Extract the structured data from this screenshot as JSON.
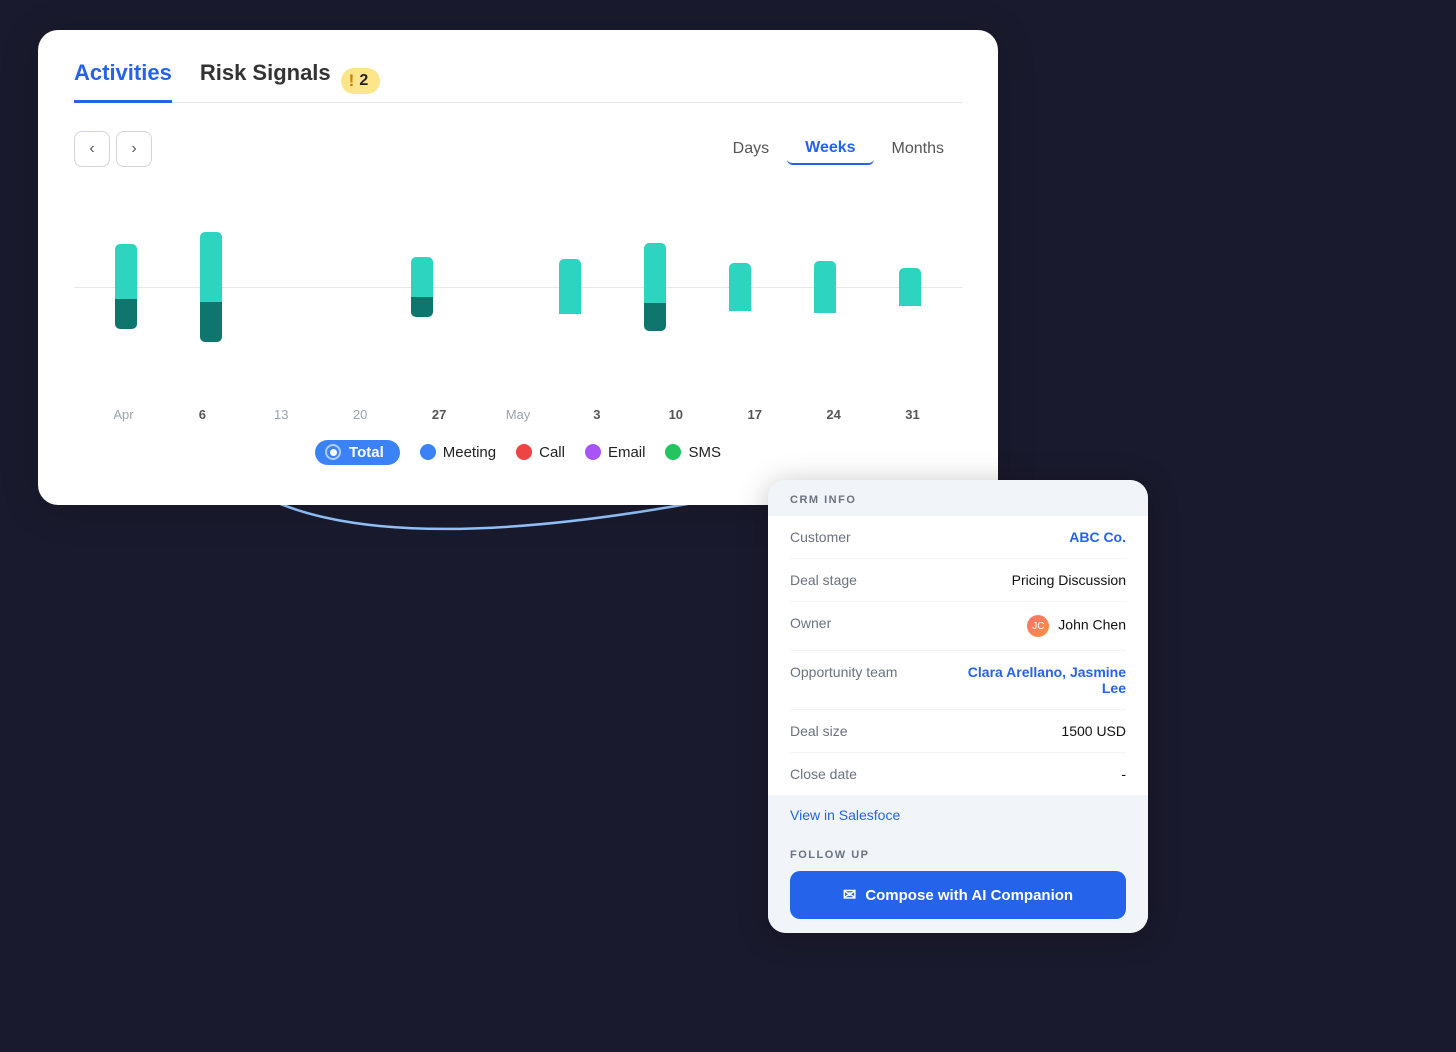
{
  "tabs": {
    "activities": "Activities",
    "risk_signals": "Risk Signals",
    "risk_count": "2"
  },
  "period": {
    "prev_label": "‹",
    "next_label": "›",
    "options": [
      "Days",
      "Weeks",
      "Months"
    ],
    "active": "Weeks"
  },
  "chart": {
    "bars": [
      {
        "label": "Apr",
        "upper": 55,
        "lower": 30,
        "bold": false
      },
      {
        "label": "6",
        "upper": 70,
        "lower": 40,
        "bold": true
      },
      {
        "label": "13",
        "upper": 0,
        "lower": 0,
        "bold": false
      },
      {
        "label": "20",
        "upper": 0,
        "lower": 0,
        "bold": false
      },
      {
        "label": "27",
        "upper": 40,
        "lower": 20,
        "bold": true
      },
      {
        "label": "May",
        "upper": 0,
        "lower": 0,
        "bold": false
      },
      {
        "label": "3",
        "upper": 55,
        "lower": 0,
        "bold": true
      },
      {
        "label": "10",
        "upper": 60,
        "lower": 28,
        "bold": true
      },
      {
        "label": "17",
        "upper": 48,
        "lower": 0,
        "bold": true
      },
      {
        "label": "24",
        "upper": 52,
        "lower": 0,
        "bold": true
      },
      {
        "label": "31",
        "upper": 38,
        "lower": 0,
        "bold": true
      }
    ]
  },
  "legend": {
    "items": [
      {
        "id": "total",
        "label": "Total",
        "color": "#06b6d4",
        "type": "pill"
      },
      {
        "id": "meeting",
        "label": "Meeting",
        "color": "#3b82f6",
        "type": "dot"
      },
      {
        "id": "call",
        "label": "Call",
        "color": "#ef4444",
        "type": "dot"
      },
      {
        "id": "email",
        "label": "Email",
        "color": "#a855f7",
        "type": "dot"
      },
      {
        "id": "sms",
        "label": "SMS",
        "color": "#22c55e",
        "type": "dot"
      }
    ]
  },
  "crm": {
    "section_header": "CRM INFO",
    "rows": [
      {
        "label": "Customer",
        "value": "ABC Co.",
        "type": "link"
      },
      {
        "label": "Deal stage",
        "value": "Pricing Discussion",
        "type": "text"
      },
      {
        "label": "Owner",
        "value": "John Chen",
        "type": "owner"
      },
      {
        "label": "Opportunity team",
        "value": "Clara Arellano, Jasmine Lee",
        "type": "team"
      },
      {
        "label": "Deal size",
        "value": "1500 USD",
        "type": "text"
      },
      {
        "label": "Close date",
        "value": "-",
        "type": "text"
      }
    ],
    "view_link": "View in Salesfoce",
    "follow_up_header": "FOLLOW UP",
    "compose_label": "Compose with AI Companion"
  }
}
